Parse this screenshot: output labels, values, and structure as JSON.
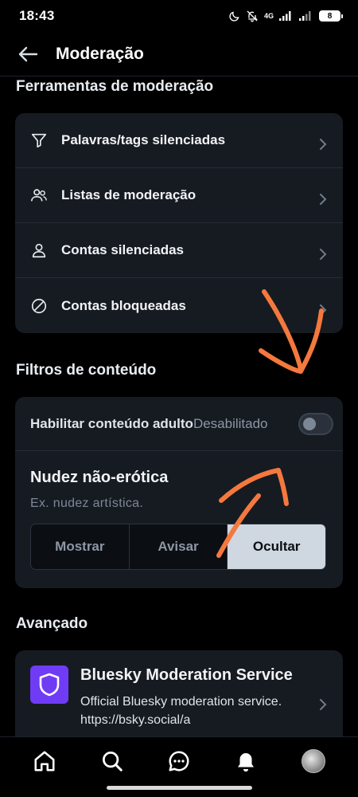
{
  "status_bar": {
    "time": "18:43",
    "network": "4G",
    "battery": "8",
    "icons": [
      "moon-icon",
      "bell-off-icon",
      "signal-icon",
      "signal-icon",
      "battery-icon"
    ]
  },
  "header": {
    "title": "Moderação",
    "back_icon": "arrow-left-icon"
  },
  "moderation_tools": {
    "title": "Ferramentas de moderação",
    "items": [
      {
        "label": "Palavras/tags silenciadas",
        "icon": "filter-icon"
      },
      {
        "label": "Listas de moderação",
        "icon": "users-icon"
      },
      {
        "label": "Contas silenciadas",
        "icon": "user-icon"
      },
      {
        "label": "Contas bloqueadas",
        "icon": "block-icon"
      }
    ]
  },
  "content_filters": {
    "title": "Filtros de conteúdo",
    "adult_label": "Habilitar conteúdo adulto",
    "adult_status": "Desabilitado",
    "adult_enabled": false,
    "nudity": {
      "title": "Nudez não-erótica",
      "description": "Ex. nudez artística.",
      "options": [
        "Mostrar",
        "Avisar",
        "Ocultar"
      ],
      "selected": "Ocultar"
    }
  },
  "advanced": {
    "title": "Avançado",
    "service": {
      "name": "Bluesky Moderation Service",
      "description": "Official Bluesky moderation service. https://bsky.social/a",
      "icon": "shield-icon"
    }
  },
  "tabbar": {
    "items": [
      "home-icon",
      "search-icon",
      "chat-icon",
      "bell-icon",
      "avatar"
    ],
    "active": "bell-icon"
  },
  "colors": {
    "background": "#000000",
    "card": "#161b22",
    "accent_purple": "#6f3bf5",
    "annotation_orange": "#f5783d"
  }
}
